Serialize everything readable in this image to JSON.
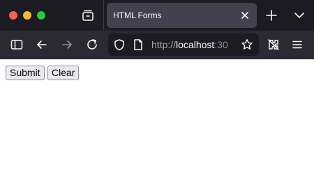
{
  "window": {
    "traffic_lights": [
      "close",
      "minimize",
      "maximize"
    ],
    "colors": {
      "close": "#ff5f57",
      "minimize": "#febc2e",
      "maximize": "#28c840"
    }
  },
  "tabs": [
    {
      "title": "HTML Forms",
      "active": true
    }
  ],
  "toolbar": {
    "icons": [
      "sidebar-icon",
      "back-arrow-icon",
      "forward-arrow-icon",
      "reload-icon",
      "extensions-icon",
      "hamburger-menu-icon"
    ],
    "forward_enabled": false
  },
  "urlbar": {
    "scheme": "http://",
    "host": "localhost",
    "port_visible": ":30",
    "icons": [
      "shield-icon",
      "page-icon",
      "bookmark-star-icon"
    ]
  },
  "page": {
    "buttons": {
      "submit_label": "Submit",
      "clear_label": "Clear"
    }
  },
  "colors": {
    "titlebar_bg": "#1c1b22",
    "active_tab_bg": "#42414d",
    "navbar_bg": "#2b2a33",
    "urlbar_bg": "#1c1b22",
    "page_bg": "#ffffff",
    "button_bg": "#e9e9ed"
  }
}
